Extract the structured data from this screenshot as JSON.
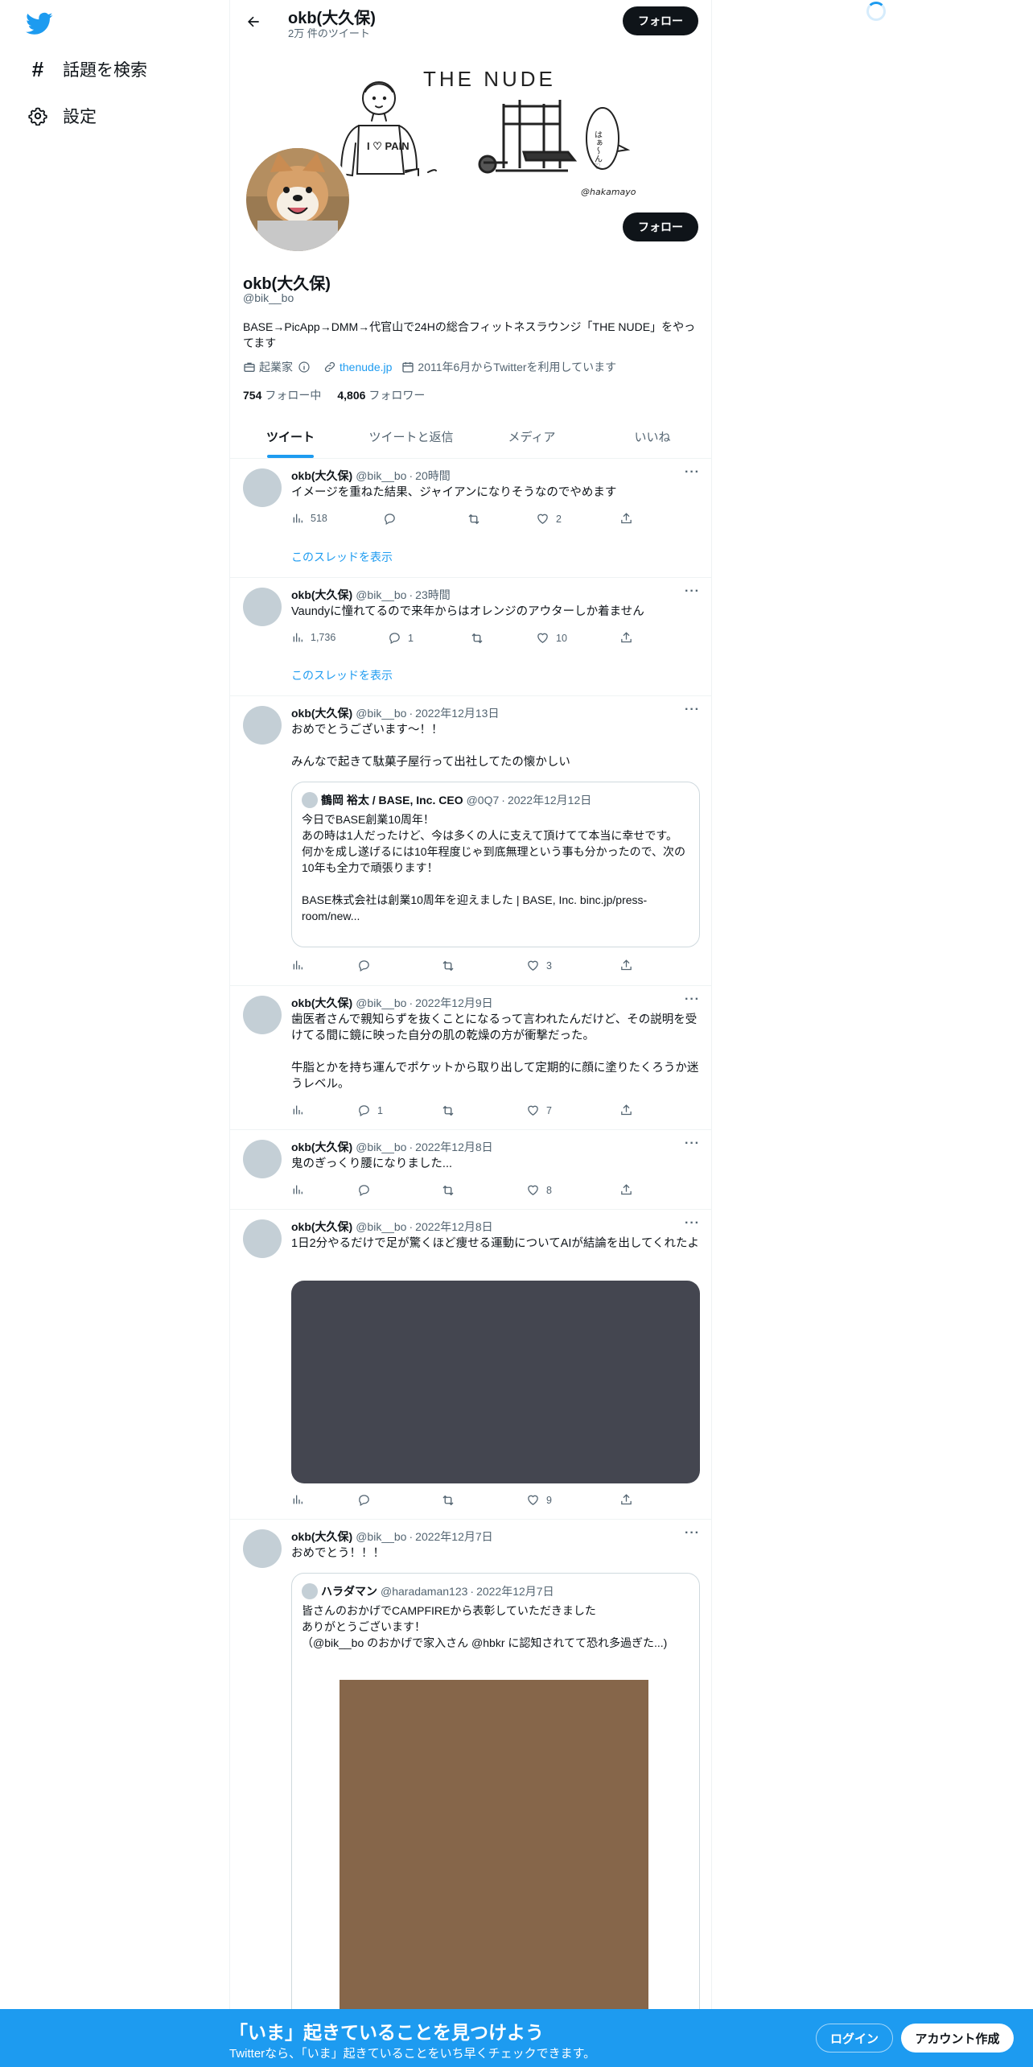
{
  "nav": {
    "logo": "twitter-bird-icon",
    "items": [
      {
        "label": "話題を検索",
        "icon": "hashtag-icon"
      },
      {
        "label": "設定",
        "icon": "gear-icon"
      }
    ]
  },
  "header": {
    "name": "okb(大久保)",
    "tweet_count": "2万 件のツイート",
    "follow_label": "フォロー"
  },
  "banner": {
    "title_text": "THE NUDE",
    "shirt_text": "I ♡ PAIN",
    "bubble_text": "はぁ〜ん♡",
    "signature": "@hakamayo"
  },
  "profile": {
    "follow_label": "フォロー",
    "name": "okb(大久保)",
    "handle": "@bik__bo",
    "bio": "BASE→PicApp→DMM→代官山で24Hの総合フィットネスラウンジ「THE NUDE」をやってます",
    "category": "起業家",
    "link": "thenude.jp",
    "joined": "2011年6月からTwitterを利用しています",
    "following_count": "754",
    "following_label": "フォロー中",
    "followers_count": "4,806",
    "followers_label": "フォロワー"
  },
  "tabs": [
    {
      "label": "ツイート",
      "active": true
    },
    {
      "label": "ツイートと返信",
      "active": false
    },
    {
      "label": "メディア",
      "active": false
    },
    {
      "label": "いいね",
      "active": false
    }
  ],
  "tweets": [
    {
      "name": "okb(大久保)",
      "handle": "@bik__bo",
      "sep": "·",
      "time": "20時間",
      "text": "イメージを重ねた結果、ジャイアンになりそうなのでやめます",
      "views": "518",
      "replies": "",
      "retweets": "",
      "likes": "2",
      "thread_link": "このスレッドを表示"
    },
    {
      "name": "okb(大久保)",
      "handle": "@bik__bo",
      "sep": "·",
      "time": "23時間",
      "text": "Vaundyに憧れてるので来年からはオレンジのアウターしか着ません",
      "views": "1,736",
      "replies": "1",
      "retweets": "",
      "likes": "10",
      "thread_link": "このスレッドを表示"
    },
    {
      "name": "okb(大久保)",
      "handle": "@bik__bo",
      "sep": "·",
      "time": "2022年12月13日",
      "text": "おめでとうございます〜！！\n\nみんなで起きて駄菓子屋行って出社してたの懐かしい",
      "quote": {
        "name": "鶴岡 裕太 / BASE, Inc. CEO",
        "handle": "@0Q7",
        "sep": "·",
        "time": "2022年12月12日",
        "text": "今日でBASE創業10周年！\nあの時は1人だったけど、今は多くの人に支えて頂けてて本当に幸せです。\n何かを成し遂げるには10年程度じゃ到底無理という事も分かったので、次の10年も全力で頑張ります！\n\nBASE株式会社は創業10周年を迎えました | BASE, Inc. binc.jp/press-room/new..."
      },
      "views": "",
      "replies": "",
      "retweets": "",
      "likes": "3"
    },
    {
      "name": "okb(大久保)",
      "handle": "@bik__bo",
      "sep": "·",
      "time": "2022年12月9日",
      "text": "歯医者さんで親知らずを抜くことになるって言われたんだけど、その説明を受けてる間に鏡に映った自分の肌の乾燥の方が衝撃だった。\n\n牛脂とかを持ち運んでポケットから取り出して定期的に顔に塗りたくろうか迷うレベル。",
      "views": "",
      "replies": "1",
      "retweets": "",
      "likes": "7"
    },
    {
      "name": "okb(大久保)",
      "handle": "@bik__bo",
      "sep": "·",
      "time": "2022年12月8日",
      "text": "鬼のぎっくり腰になりました...",
      "views": "",
      "replies": "",
      "retweets": "",
      "likes": "8"
    },
    {
      "name": "okb(大久保)",
      "handle": "@bik__bo",
      "sep": "·",
      "time": "2022年12月8日",
      "text": "1日2分やるだけで足が驚くほど痩せる運動についてAIが結論を出してくれたよ",
      "media_color": "#444650",
      "views": "",
      "replies": "",
      "retweets": "",
      "likes": "9"
    },
    {
      "name": "okb(大久保)",
      "handle": "@bik__bo",
      "sep": "·",
      "time": "2022年12月7日",
      "text": "おめでとう！！！",
      "quote": {
        "name": "ハラダマン",
        "handle": "@haradaman123",
        "sep": "·",
        "time": "2022年12月7日",
        "text": "皆さんのおかげでCAMPFIREから表彰していただきました\nありがとうございます！\n（@bik__bo のおかげで家入さん @hbkr に認知されてて恐れ多過ぎた...)"
      },
      "media_color": "#86664a"
    }
  ],
  "bottom": {
    "title": "「いま」起きていることを見つけよう",
    "subtitle": "Twitterなら、「いま」起きていることをいち早くチェックできます。",
    "login": "ログイン",
    "signup": "アカウント作成"
  },
  "colors": {
    "accent": "#1d9bf0",
    "text": "#0f1419",
    "muted": "#536471"
  }
}
